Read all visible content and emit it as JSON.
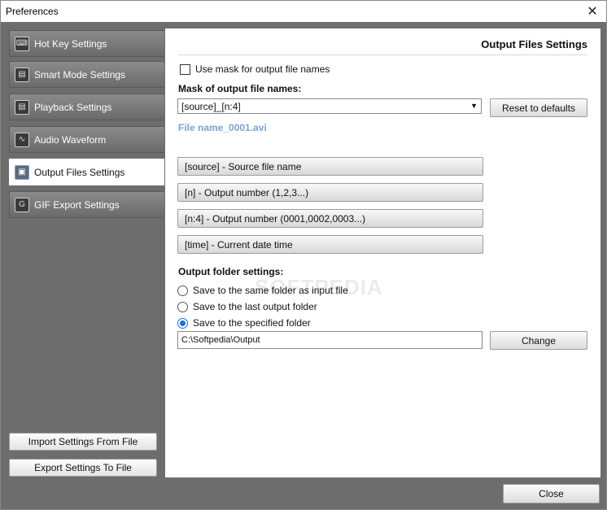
{
  "window": {
    "title": "Preferences"
  },
  "sidebar": {
    "items": [
      {
        "label": "Hot Key Settings",
        "icon": "keyboard-icon",
        "active": false
      },
      {
        "label": "Smart Mode Settings",
        "icon": "film-icon",
        "active": false
      },
      {
        "label": "Playback Settings",
        "icon": "film-icon",
        "active": false
      },
      {
        "label": "Audio Waveform",
        "icon": "waveform-icon",
        "active": false
      },
      {
        "label": "Output Files Settings",
        "icon": "floppy-icon",
        "active": true
      },
      {
        "label": "GIF Export Settings",
        "icon": "gif-icon",
        "active": false
      }
    ],
    "import_label": "Import Settings From File",
    "export_label": "Export Settings To File"
  },
  "panel": {
    "title": "Output Files Settings",
    "use_mask_label": "Use mask for output file names",
    "use_mask_checked": false,
    "mask_heading": "Mask of output file names:",
    "mask_value": "[source]_[n:4]",
    "reset_label": "Reset to defaults",
    "preview": "File name_0001.avi",
    "tokens": [
      "[source] - Source file name",
      "[n] - Output number (1,2,3...)",
      "[n:4] - Output number (0001,0002,0003...)",
      "[time] - Current date time"
    ],
    "folder_heading": "Output folder settings:",
    "folder_options": [
      {
        "label": "Save to the same folder as input file",
        "selected": false
      },
      {
        "label": "Save to the last output folder",
        "selected": false
      },
      {
        "label": "Save to the specified folder",
        "selected": true
      }
    ],
    "folder_path": "C:\\Softpedia\\Output",
    "change_label": "Change",
    "watermark": "SOFTPEDIA"
  },
  "footer": {
    "close_label": "Close"
  },
  "colors": {
    "accent": "#1e6fd9",
    "preview_text": "#7ba3d6",
    "sidebar_bg": "#6d6d6d"
  }
}
